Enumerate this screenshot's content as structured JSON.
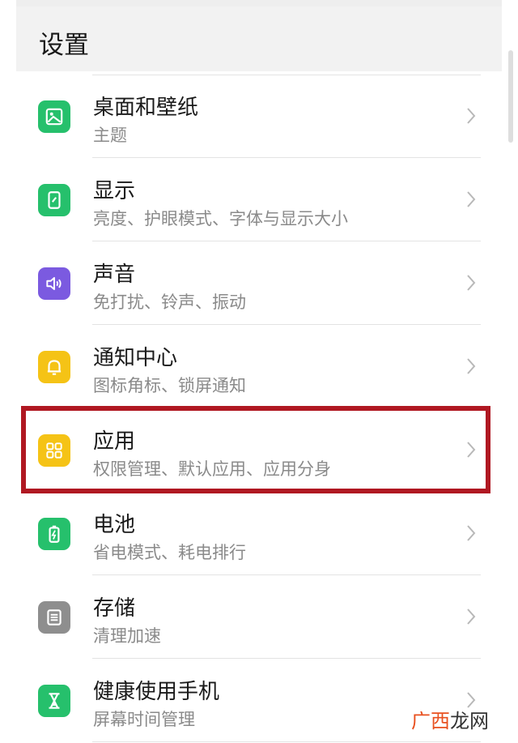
{
  "header": {
    "title": "设置"
  },
  "colors": {
    "green": "#26c06c",
    "purple": "#7b5ae0",
    "yellow": "#f5c316",
    "gray": "#8e8e8e",
    "highlight": "#b01822"
  },
  "items": [
    {
      "title": "桌面和壁纸",
      "subtitle": "主题",
      "icon": "wallpaper-icon",
      "icon_color": "#26c06c"
    },
    {
      "title": "显示",
      "subtitle": "亮度、护眼模式、字体与显示大小",
      "icon": "display-icon",
      "icon_color": "#26c06c"
    },
    {
      "title": "声音",
      "subtitle": "免打扰、铃声、振动",
      "icon": "sound-icon",
      "icon_color": "#7b5ae0"
    },
    {
      "title": "通知中心",
      "subtitle": "图标角标、锁屏通知",
      "icon": "bell-icon",
      "icon_color": "#f5c316"
    },
    {
      "title": "应用",
      "subtitle": "权限管理、默认应用、应用分身",
      "icon": "apps-grid-icon",
      "icon_color": "#f5c316",
      "highlighted": true
    },
    {
      "title": "电池",
      "subtitle": "省电模式、耗电排行",
      "icon": "battery-icon",
      "icon_color": "#26c06c"
    },
    {
      "title": "存储",
      "subtitle": "清理加速",
      "icon": "storage-icon",
      "icon_color": "#8e8e8e"
    },
    {
      "title": "健康使用手机",
      "subtitle": "屏幕时间管理",
      "icon": "hourglass-icon",
      "icon_color": "#26c06c"
    }
  ],
  "watermark": {
    "part1": "广西",
    "part2": "龙网"
  }
}
